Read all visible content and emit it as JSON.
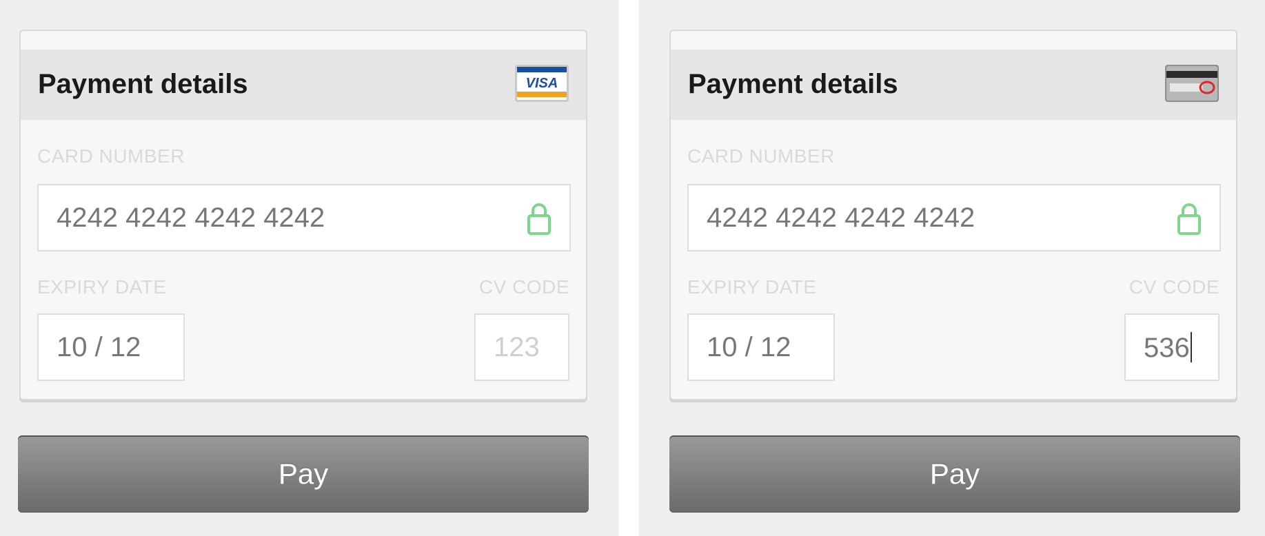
{
  "panels": [
    {
      "title": "Payment details",
      "card_icon": "visa-card-icon",
      "card_number_label": "CARD NUMBER",
      "card_number": "4242 4242 4242 4242",
      "expiry_label": "EXPIRY DATE",
      "expiry": "10 / 12",
      "cvc_label": "CV CODE",
      "cvc_placeholder": "123",
      "cvc_value": "",
      "pay_label": "Pay"
    },
    {
      "title": "Payment details",
      "card_icon": "card-back-cvc-icon",
      "card_number_label": "CARD NUMBER",
      "card_number": "4242 4242 4242 4242",
      "expiry_label": "EXPIRY DATE",
      "expiry": "10 / 12",
      "cvc_label": "CV CODE",
      "cvc_placeholder": "",
      "cvc_value": "536",
      "pay_label": "Pay"
    }
  ],
  "colors": {
    "panel_bg": "#efefef",
    "header_bg": "#e6e6e6",
    "lock_green": "#7dd68a",
    "visa_blue": "#1a4fa0",
    "visa_orange": "#f0a31c",
    "pay_button": "#7d7d7d"
  }
}
